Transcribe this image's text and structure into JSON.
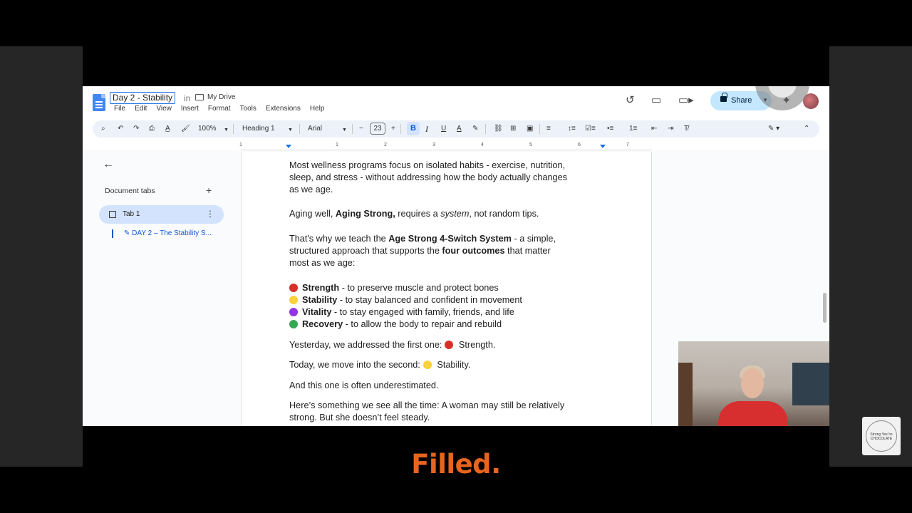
{
  "document": {
    "title": "Day 2 - Stability",
    "in_label": "in",
    "location": "My Drive"
  },
  "menu": [
    "File",
    "Edit",
    "View",
    "Insert",
    "Format",
    "Tools",
    "Extensions",
    "Help"
  ],
  "header": {
    "share_label": "Share"
  },
  "toolbar": {
    "zoom": "100%",
    "style": "Heading 1",
    "font": "Arial",
    "font_size": "23"
  },
  "ruler": [
    "1",
    "1",
    "2",
    "3",
    "4",
    "5",
    "6",
    "7"
  ],
  "sidebar": {
    "heading": "Document tabs",
    "tab_label": "Tab 1",
    "outline_item": "DAY 2 – The Stability S..."
  },
  "content": {
    "p1": [
      "Most wellness programs focus on isolated habits - exercise, nutrition,",
      "sleep, and stress - without addressing how the body actually changes",
      "as we age."
    ],
    "p2": {
      "a": "Aging well, ",
      "b": "Aging Strong,",
      "c": " requires a ",
      "d": "system",
      "e": ", not random tips."
    },
    "p3": {
      "l1a": "That's why we teach the ",
      "l1b": "Age Strong 4-Switch System",
      "l1c": " - a simple,",
      "l2a": "structured approach that supports the ",
      "l2b": "four outcomes",
      "l2c": " that matter",
      "l3": "most as we age:"
    },
    "outcomes": [
      {
        "name": "Strength",
        "desc": " - to preserve muscle and protect bones",
        "color": "#d93025"
      },
      {
        "name": "Stability",
        "desc": " - to stay balanced and confident in movement",
        "color": "#fbd13c"
      },
      {
        "name": "Vitality",
        "desc": " - to stay engaged with family, friends, and life",
        "color": "#9334e6"
      },
      {
        "name": "Recovery",
        "desc": " - to allow the body to repair and rebuild",
        "color": "#34a853"
      }
    ],
    "p5": {
      "a": "Yesterday, we addressed the first one:",
      "b": " Strength."
    },
    "p6": {
      "a": "Today, we move into the second:",
      "b": " Stability."
    },
    "p7": "And this one is often underestimated.",
    "p8": [
      "Here’s something we see all the time: A woman may still be relatively",
      "strong. But she doesn’t feel steady."
    ]
  },
  "logo_text": "Strong Yes! to CHOCOLATE",
  "caption": "Filled."
}
